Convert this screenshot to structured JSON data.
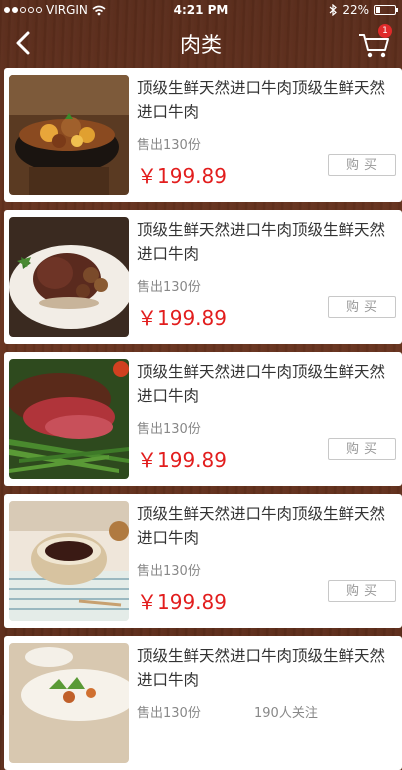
{
  "status_bar": {
    "carrier": "VIRGIN",
    "time": "4:21 PM",
    "battery": "22%",
    "battery_level": 0.22
  },
  "nav": {
    "title": "肉类",
    "cart_count": "1"
  },
  "products": [
    {
      "title": "顶级生鲜天然进口牛肉顶级生鲜天然进口牛肉",
      "sold": "售出130份",
      "price": "￥199.89",
      "buy": "购买",
      "image": "beef-stew-bowl"
    },
    {
      "title": "顶级生鲜天然进口牛肉顶级生鲜天然进口牛肉",
      "sold": "售出130份",
      "price": "￥199.89",
      "buy": "购买",
      "image": "steak-plate"
    },
    {
      "title": "顶级生鲜天然进口牛肉顶级生鲜天然进口牛肉",
      "sold": "售出130份",
      "price": "￥199.89",
      "buy": "购买",
      "image": "roast-beef-green-beans"
    },
    {
      "title": "顶级生鲜天然进口牛肉顶级生鲜天然进口牛肉",
      "sold": "售出130份",
      "price": "￥199.89",
      "buy": "购买",
      "image": "meat-sauce-bowl"
    },
    {
      "title": "顶级生鲜天然进口牛肉顶级生鲜天然进口牛肉",
      "sold": "售出130份",
      "follow": "190人关注",
      "image": "salad-plate"
    }
  ]
}
